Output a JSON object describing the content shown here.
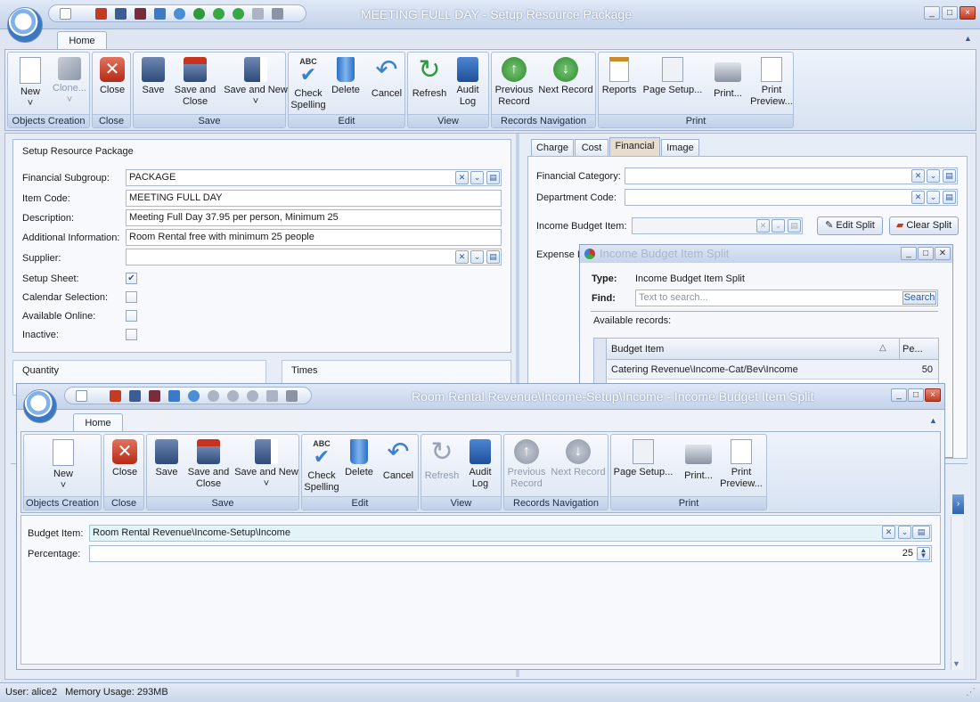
{
  "main_window": {
    "title": "MEETING FULL DAY - Setup Resource Package",
    "tab_home": "Home",
    "ribbon": {
      "new": "New",
      "clone": "Clone...",
      "close": "Close",
      "save": "Save",
      "save_close_1": "Save and",
      "save_close_2": "Close",
      "save_new": "Save and New",
      "check_1": "Check",
      "check_2": "Spelling",
      "delete": "Delete",
      "cancel": "Cancel",
      "refresh": "Refresh",
      "audit_1": "Audit",
      "audit_2": "Log",
      "prev_1": "Previous",
      "prev_2": "Record",
      "next": "Next Record",
      "reports": "Reports",
      "page_setup": "Page Setup...",
      "print": "Print...",
      "preview_1": "Print",
      "preview_2": "Preview...",
      "groups": {
        "objects": "Objects Creation",
        "close": "Close",
        "save": "Save",
        "edit": "Edit",
        "view": "View",
        "records": "Records Navigation",
        "print": "Print"
      }
    }
  },
  "setup_panel": {
    "header": "Setup Resource Package",
    "financial_subgroup_label": "Financial Subgroup:",
    "financial_subgroup_value": "PACKAGE",
    "item_code_label": "Item Code:",
    "item_code_value": "MEETING FULL DAY",
    "description_label": "Description:",
    "description_value": "Meeting Full Day 37.95 per person, Minimum 25",
    "additional_label": "Additional Information:",
    "additional_value": "Room Rental free with minimum 25 people",
    "supplier_label": "Supplier:",
    "setup_sheet_label": "Setup Sheet:",
    "calendar_label": "Calendar Selection:",
    "available_label": "Available Online:",
    "inactive_label": "Inactive:",
    "quantity_header": "Quantity",
    "times_header": "Times"
  },
  "financial_panel": {
    "tabs": [
      "Charge",
      "Cost",
      "Financial",
      "Image"
    ],
    "category_label": "Financial Category:",
    "department_label": "Department Code:",
    "income_budget_label": "Income Budget Item:",
    "expense_label": "Expense I",
    "edit_split": "Edit Split",
    "clear_split": "Clear Split"
  },
  "split_list_window": {
    "title": "Income Budget Item Split",
    "type_label": "Type:",
    "type_value": "Income Budget Item Split",
    "find_label": "Find:",
    "search_placeholder": "Text to search...",
    "search_button": "Search",
    "available_label": "Available records:",
    "columns": [
      "Budget Item",
      "Pe..."
    ],
    "rows": [
      {
        "item": "Catering Revenue\\Income-Cat/Bev\\Income",
        "pct": "50"
      }
    ]
  },
  "split_edit_window": {
    "title": "Room Rental Revenue\\Income-Setup\\Income - Income Budget Item Split",
    "tab_home": "Home",
    "ribbon": {
      "new": "New",
      "close": "Close",
      "save": "Save",
      "save_close_1": "Save and",
      "save_close_2": "Close",
      "save_new": "Save and New",
      "check_1": "Check",
      "check_2": "Spelling",
      "delete": "Delete",
      "cancel": "Cancel",
      "refresh": "Refresh",
      "audit_1": "Audit",
      "audit_2": "Log",
      "prev_1": "Previous",
      "prev_2": "Record",
      "next": "Next Record",
      "page_setup": "Page Setup...",
      "print": "Print...",
      "preview_1": "Print",
      "preview_2": "Preview...",
      "groups": {
        "objects": "Objects Creation",
        "close": "Close",
        "save": "Save",
        "edit": "Edit",
        "view": "View",
        "records": "Records Navigation",
        "print": "Print"
      }
    },
    "budget_item_label": "Budget Item:",
    "budget_item_value": "Room Rental Revenue\\Income-Setup\\Income",
    "percentage_label": "Percentage:",
    "percentage_value": "25"
  },
  "status_bar": {
    "user": "User: alice2",
    "memory": "Memory Usage: 293MB"
  }
}
